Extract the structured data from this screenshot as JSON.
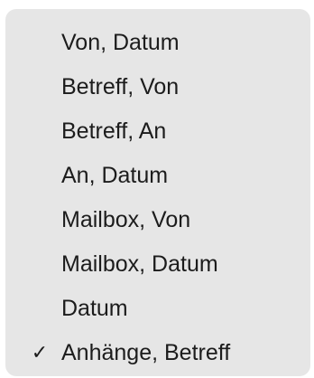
{
  "menu": {
    "items": [
      {
        "label": "Von, Datum",
        "checked": false
      },
      {
        "label": "Betreff, Von",
        "checked": false
      },
      {
        "label": "Betreff, An",
        "checked": false
      },
      {
        "label": "An, Datum",
        "checked": false
      },
      {
        "label": "Mailbox, Von",
        "checked": false
      },
      {
        "label": "Mailbox, Datum",
        "checked": false
      },
      {
        "label": "Datum",
        "checked": false
      },
      {
        "label": "Anhänge, Betreff",
        "checked": true
      }
    ],
    "checkmark_glyph": "✓"
  }
}
